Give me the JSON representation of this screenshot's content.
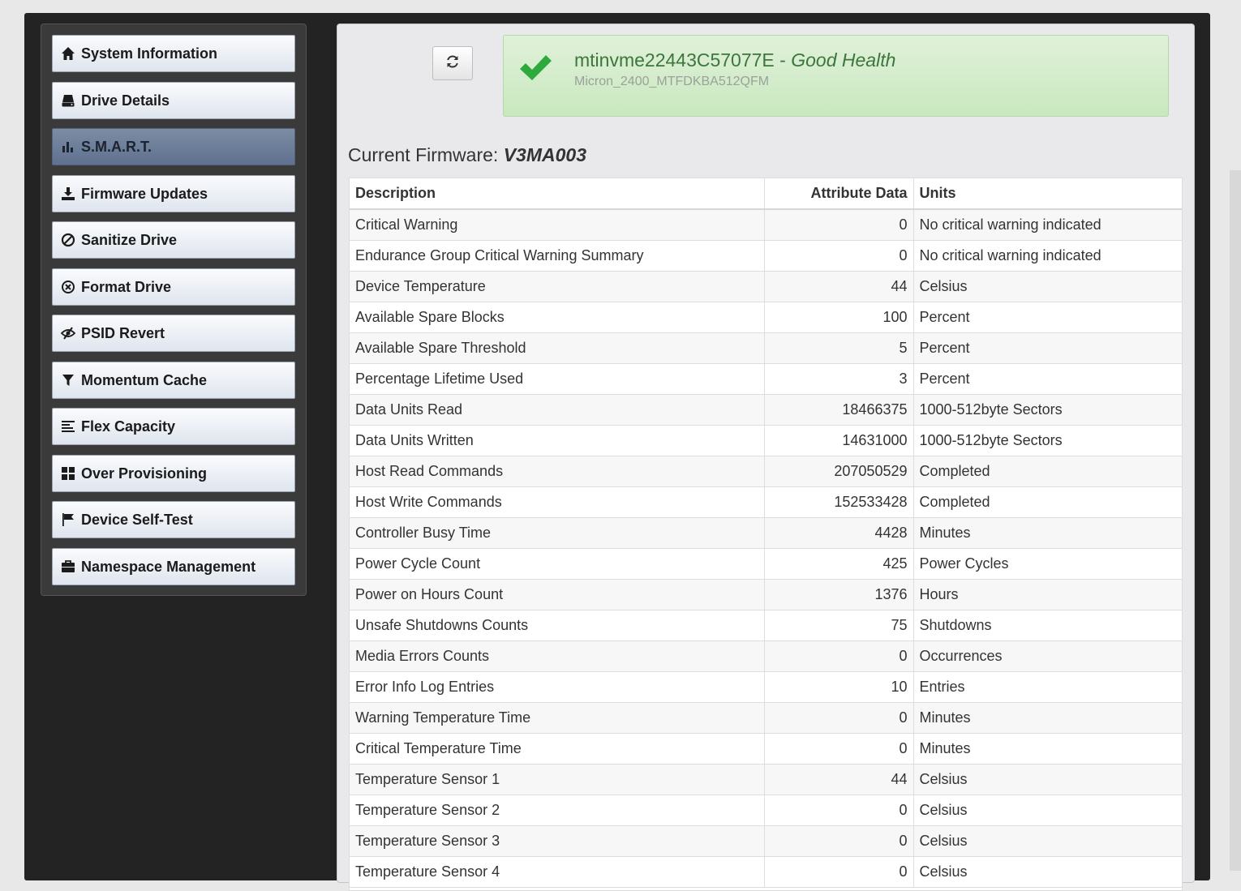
{
  "sidebar": {
    "items": [
      {
        "label": "System Information",
        "icon": "home-icon"
      },
      {
        "label": "Drive Details",
        "icon": "hdd-icon"
      },
      {
        "label": "S.M.A.R.T.",
        "icon": "bar-chart-icon"
      },
      {
        "label": "Firmware Updates",
        "icon": "download-icon"
      },
      {
        "label": "Sanitize Drive",
        "icon": "ban-icon"
      },
      {
        "label": "Format Drive",
        "icon": "circle-x-icon"
      },
      {
        "label": "PSID Revert",
        "icon": "eye-slash-icon"
      },
      {
        "label": "Momentum Cache",
        "icon": "filter-icon"
      },
      {
        "label": "Flex Capacity",
        "icon": "align-left-icon"
      },
      {
        "label": "Over Provisioning",
        "icon": "grid-icon"
      },
      {
        "label": "Device Self-Test",
        "icon": "flag-icon"
      },
      {
        "label": "Namespace Management",
        "icon": "briefcase-icon"
      }
    ],
    "active_label": "S.M.A.R.T."
  },
  "health": {
    "serial": "mtinvme22443C57077E",
    "separator": " - ",
    "status": "Good Health",
    "model": "Micron_2400_MTFDKBA512QFM",
    "status_color": "#3c763d"
  },
  "firmware": {
    "label": "Current Firmware: ",
    "value": "V3MA003"
  },
  "table": {
    "headers": [
      "Description",
      "Attribute Data",
      "Units"
    ],
    "rows": [
      [
        "Critical Warning",
        "0",
        "No critical warning indicated"
      ],
      [
        "Endurance Group Critical Warning Summary",
        "0",
        "No critical warning indicated"
      ],
      [
        "Device Temperature",
        "44",
        "Celsius"
      ],
      [
        "Available Spare Blocks",
        "100",
        "Percent"
      ],
      [
        "Available Spare Threshold",
        "5",
        "Percent"
      ],
      [
        "Percentage Lifetime Used",
        "3",
        "Percent"
      ],
      [
        "Data Units Read",
        "18466375",
        "1000-512byte Sectors"
      ],
      [
        "Data Units Written",
        "14631000",
        "1000-512byte Sectors"
      ],
      [
        "Host Read Commands",
        "207050529",
        "Completed"
      ],
      [
        "Host Write Commands",
        "152533428",
        "Completed"
      ],
      [
        "Controller Busy Time",
        "4428",
        "Minutes"
      ],
      [
        "Power Cycle Count",
        "425",
        "Power Cycles"
      ],
      [
        "Power on Hours Count",
        "1376",
        "Hours"
      ],
      [
        "Unsafe Shutdowns Counts",
        "75",
        "Shutdowns"
      ],
      [
        "Media Errors Counts",
        "0",
        "Occurrences"
      ],
      [
        "Error Info Log Entries",
        "10",
        "Entries"
      ],
      [
        "Warning Temperature Time",
        "0",
        "Minutes"
      ],
      [
        "Critical Temperature Time",
        "0",
        "Minutes"
      ],
      [
        "Temperature Sensor 1",
        "44",
        "Celsius"
      ],
      [
        "Temperature Sensor 2",
        "0",
        "Celsius"
      ],
      [
        "Temperature Sensor 3",
        "0",
        "Celsius"
      ],
      [
        "Temperature Sensor 4",
        "0",
        "Celsius"
      ]
    ]
  }
}
